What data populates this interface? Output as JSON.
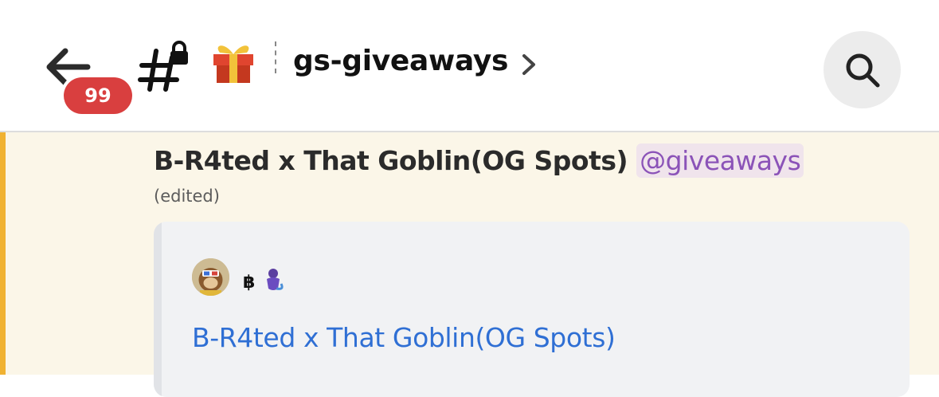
{
  "header": {
    "unread_badge": "99",
    "channel_name": "gs-giveaways",
    "icons": {
      "back": "arrow-left-icon",
      "channel": "hashtag-lock-icon",
      "emoji": "gift-icon",
      "chevron": "chevron-right-icon",
      "search": "search-icon"
    }
  },
  "message": {
    "title": "B-R4ted x That Goblin(OG Spots)",
    "mention": "@giveaways",
    "edited_label": "(edited)",
    "embed": {
      "author_avatar": "monkey-avatar-icon",
      "author_glyphs": "bitcoin-genie-icon",
      "title": "B-R4ted x That Goblin(OG Spots)"
    }
  },
  "colors": {
    "badge": "#d93f3f",
    "mention_highlight_bg": "#fbf6e8",
    "mention_bar": "#f0b232",
    "mention_text": "#8b53b8",
    "mention_bg": "#f0e4ec",
    "embed_bg": "#f1f2f4",
    "link": "#2f6fd4"
  }
}
